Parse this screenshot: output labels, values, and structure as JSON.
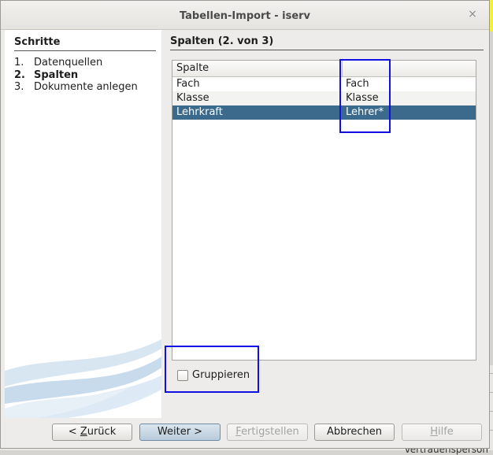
{
  "dialog": {
    "title": "Tabellen-Import - iserv",
    "close_glyph": "×"
  },
  "steps": {
    "title": "Schritte",
    "items": [
      {
        "num": "1.",
        "label": "Datenquellen"
      },
      {
        "num": "2.",
        "label": "Spalten"
      },
      {
        "num": "3.",
        "label": "Dokumente anlegen"
      }
    ],
    "active_index": 1
  },
  "page": {
    "title": "Spalten (2. von 3)"
  },
  "table": {
    "header": {
      "col1": "Spalte",
      "col2": ""
    },
    "rows": [
      {
        "c1": "Fach",
        "c2": "Fach"
      },
      {
        "c1": "Klasse",
        "c2": "Klasse"
      },
      {
        "c1": "Lehrkraft",
        "c2": "Lehrer*"
      }
    ],
    "selected_row": 2
  },
  "group_checkbox": {
    "label": "Gruppieren",
    "checked": false
  },
  "buttons": {
    "back": {
      "prefix": "< ",
      "mnemonic": "Z",
      "rest": "urück"
    },
    "next": {
      "label": "Weiter >"
    },
    "finish": {
      "mnemonic": "F",
      "rest": "ertigstellen"
    },
    "cancel": {
      "label": "Abbrechen"
    },
    "help": {
      "mnemonic": "H",
      "rest": "ilfe"
    }
  },
  "background": {
    "partial_text": "Vertrauensperson"
  },
  "colors": {
    "selection": "#3c6a8c",
    "annotation_box": "#1010e0",
    "background_highlight": "#f3ef3a"
  }
}
